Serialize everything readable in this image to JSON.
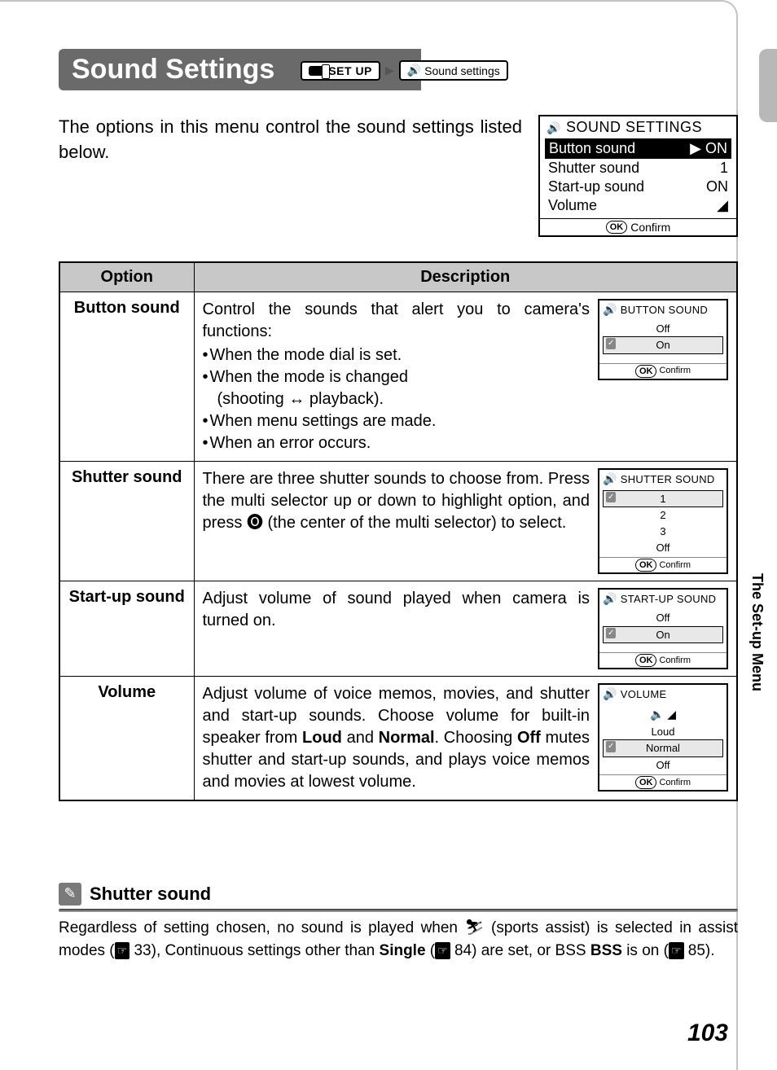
{
  "header": {
    "title": "Sound Settings",
    "breadcrumb_setup": "SET UP",
    "breadcrumb_item": "Sound settings"
  },
  "intro": "The options in this menu control the sound settings listed below.",
  "main_screen": {
    "title": "SOUND SETTINGS",
    "rows": [
      {
        "label": "Button sound",
        "value": "ON",
        "selected": true
      },
      {
        "label": "Shutter sound",
        "value": "1",
        "selected": false
      },
      {
        "label": "Start-up sound",
        "value": "ON",
        "selected": false
      },
      {
        "label": "Volume",
        "value": "◢",
        "selected": false
      }
    ],
    "confirm": "Confirm"
  },
  "table": {
    "head_option": "Option",
    "head_desc": "Description",
    "rows": [
      {
        "option": "Button sound",
        "desc_lead": "Control the sounds that alert you to camera's functions:",
        "bullets": [
          "When the mode dial is set.",
          "When the mode is changed",
          "(shooting ↔ playback).",
          "When menu settings are made.",
          "When an error occurs."
        ],
        "thumb": {
          "title": "BUTTON SOUND",
          "options": [
            "Off",
            "On"
          ],
          "sel": 1,
          "confirm": "Confirm"
        }
      },
      {
        "option": "Shutter sound",
        "desc_lead": "There are three shutter sounds to choose from. Press the multi selector up or down to highlight option, and press 🅞 (the center of the multi selector) to select.",
        "bullets": [],
        "thumb": {
          "title": "SHUTTER SOUND",
          "options": [
            "1",
            "2",
            "3",
            "Off"
          ],
          "sel": 0,
          "confirm": "Confirm"
        }
      },
      {
        "option": "Start-up sound",
        "desc_lead": "Adjust volume of sound played when camera is turned on.",
        "bullets": [],
        "thumb": {
          "title": "START-UP SOUND",
          "options": [
            "Off",
            "On"
          ],
          "sel": 1,
          "confirm": "Confirm"
        }
      },
      {
        "option": "Volume",
        "desc_html": "Adjust volume of voice memos, movies, and shutter and start-up sounds. Choose volume for built-in speaker from <b>Loud</b> and <b>Normal</b>. Choosing <b>Off</b> mutes shutter and start-up sounds, and plays voice memos and movies at lowest volume.",
        "thumb": {
          "title": "VOLUME",
          "pre_icons": true,
          "options": [
            "Loud",
            "Normal",
            "Off"
          ],
          "sel": 1,
          "confirm": "Confirm"
        }
      }
    ]
  },
  "note": {
    "title": "Shutter sound",
    "text_pre": "Regardless of setting chosen, no sound is played when ",
    "sports_icon": "⛷",
    "text_mid1": " (sports assist) is selected in assist modes (",
    "ref1": "33",
    "text_mid2": "), Continuous settings other than ",
    "single": "Single",
    "text_mid3": " (",
    "ref2": "84",
    "text_mid4": ") are set, or ",
    "bss": "BSS",
    "text_mid5": " is on (",
    "ref3": "85",
    "text_end": ")."
  },
  "side_tab": "The Set-up Menu",
  "page_number": "103"
}
